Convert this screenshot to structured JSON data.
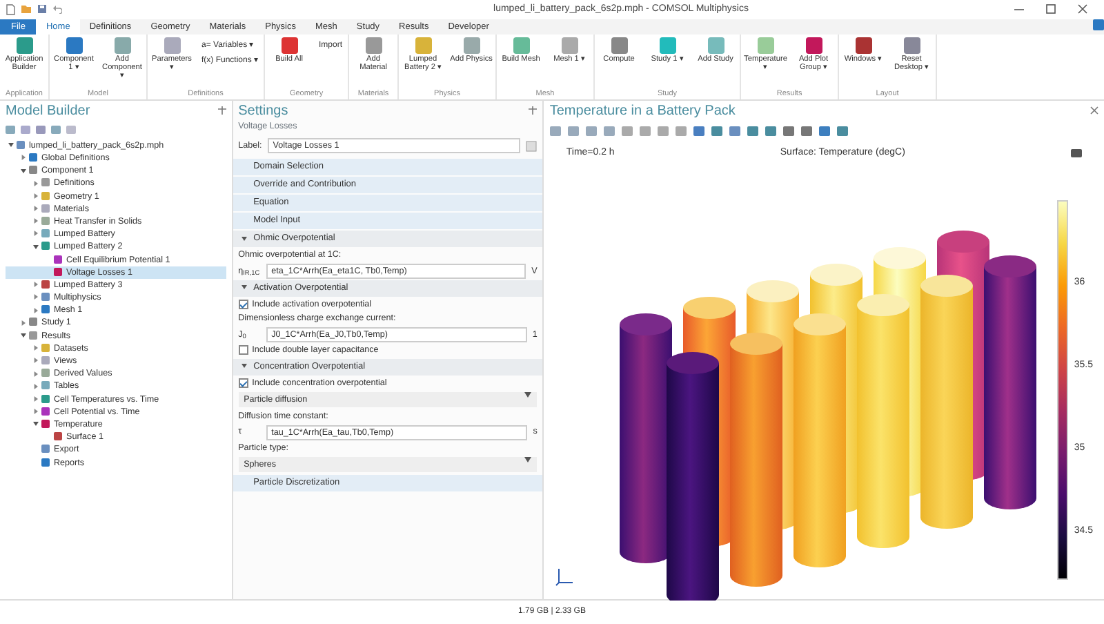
{
  "window": {
    "title": "lumped_li_battery_pack_6s2p.mph - COMSOL Multiphysics"
  },
  "menu_tabs": [
    {
      "label": "File",
      "kind": "file",
      "selected": false
    },
    {
      "label": "Home",
      "kind": "tab",
      "selected": true
    },
    {
      "label": "Definitions",
      "kind": "tab",
      "selected": false
    },
    {
      "label": "Geometry",
      "kind": "tab",
      "selected": false
    },
    {
      "label": "Materials",
      "kind": "tab",
      "selected": false
    },
    {
      "label": "Physics",
      "kind": "tab",
      "selected": false
    },
    {
      "label": "Mesh",
      "kind": "tab",
      "selected": false
    },
    {
      "label": "Study",
      "kind": "tab",
      "selected": false
    },
    {
      "label": "Results",
      "kind": "tab",
      "selected": false
    },
    {
      "label": "Developer",
      "kind": "tab",
      "selected": false
    }
  ],
  "ribbon": [
    {
      "label": "Application",
      "buttons": [
        {
          "label": "Application Builder",
          "kind": "large"
        }
      ]
    },
    {
      "label": "Model",
      "buttons": [
        {
          "label": "Component 1 ▾",
          "kind": "large"
        },
        {
          "label": "Add Component ▾",
          "kind": "large"
        }
      ]
    },
    {
      "label": "Definitions",
      "buttons": [
        {
          "label": "Parameters ▾",
          "kind": "large"
        },
        {
          "label": "a= Variables ▾",
          "kind": "small"
        },
        {
          "label": "f(x) Functions ▾",
          "kind": "small"
        }
      ]
    },
    {
      "label": "Geometry",
      "buttons": [
        {
          "label": "Build All",
          "kind": "large"
        },
        {
          "label": "Import",
          "kind": "small"
        }
      ]
    },
    {
      "label": "Materials",
      "buttons": [
        {
          "label": "Add Material",
          "kind": "large"
        }
      ]
    },
    {
      "label": "Physics",
      "buttons": [
        {
          "label": "Lumped Battery 2 ▾",
          "kind": "large"
        },
        {
          "label": "Add Physics",
          "kind": "large"
        }
      ]
    },
    {
      "label": "Mesh",
      "buttons": [
        {
          "label": "Build Mesh",
          "kind": "large"
        },
        {
          "label": "Mesh 1 ▾",
          "kind": "large"
        }
      ]
    },
    {
      "label": "Study",
      "buttons": [
        {
          "label": "Compute",
          "kind": "large"
        },
        {
          "label": "Study 1 ▾",
          "kind": "large"
        },
        {
          "label": "Add Study",
          "kind": "large"
        }
      ]
    },
    {
      "label": "Results",
      "buttons": [
        {
          "label": "Temperature ▾",
          "kind": "large"
        },
        {
          "label": "Add Plot Group ▾",
          "kind": "large"
        }
      ]
    },
    {
      "label": "Layout",
      "buttons": [
        {
          "label": "Windows ▾",
          "kind": "large"
        },
        {
          "label": "Reset Desktop ▾",
          "kind": "large"
        }
      ]
    }
  ],
  "model_builder": {
    "title": "Model Builder",
    "tree": [
      {
        "label": "lumped_li_battery_pack_6s2p.mph",
        "expanded": true,
        "selected": false,
        "children": [
          {
            "label": "Global Definitions",
            "expanded": false,
            "selected": false
          },
          {
            "label": "Component 1",
            "expanded": true,
            "selected": false,
            "children": [
              {
                "label": "Definitions",
                "expanded": false,
                "selected": false
              },
              {
                "label": "Geometry 1",
                "expanded": false,
                "selected": false
              },
              {
                "label": "Materials",
                "expanded": false,
                "selected": false
              },
              {
                "label": "Heat Transfer in Solids",
                "expanded": false,
                "selected": false
              },
              {
                "label": "Lumped Battery",
                "expanded": false,
                "selected": false
              },
              {
                "label": "Lumped Battery 2",
                "expanded": true,
                "selected": false,
                "children": [
                  {
                    "label": "Cell Equilibrium Potential 1",
                    "selected": false
                  },
                  {
                    "label": "Voltage Losses 1",
                    "selected": true
                  }
                ]
              },
              {
                "label": "Lumped Battery 3",
                "expanded": false,
                "selected": false
              },
              {
                "label": "Multiphysics",
                "expanded": false,
                "selected": false
              },
              {
                "label": "Mesh 1",
                "expanded": false,
                "selected": false
              }
            ]
          },
          {
            "label": "Study 1",
            "expanded": false,
            "selected": false
          },
          {
            "label": "Results",
            "expanded": true,
            "selected": false,
            "children": [
              {
                "label": "Datasets",
                "expanded": false,
                "selected": false
              },
              {
                "label": "Views",
                "expanded": false,
                "selected": false
              },
              {
                "label": "Derived Values",
                "expanded": false,
                "selected": false
              },
              {
                "label": "Tables",
                "expanded": false,
                "selected": false
              },
              {
                "label": "Cell Temperatures vs. Time",
                "expanded": false,
                "selected": false
              },
              {
                "label": "Cell Potential vs. Time",
                "expanded": false,
                "selected": false
              },
              {
                "label": "Temperature",
                "expanded": true,
                "selected": false,
                "children": [
                  {
                    "label": "Surface 1",
                    "selected": false
                  }
                ]
              },
              {
                "label": "Export",
                "selected": false
              },
              {
                "label": "Reports",
                "selected": false
              }
            ]
          }
        ]
      }
    ]
  },
  "settings": {
    "title": "Settings",
    "subtitle": "Voltage Losses",
    "label_caption": "Label:",
    "label_value": "Voltage Losses 1",
    "items": [
      {
        "kind": "section",
        "title": "Domain Selection",
        "expanded": false
      },
      {
        "kind": "section",
        "title": "Override and Contribution",
        "expanded": false
      },
      {
        "kind": "section",
        "title": "Equation",
        "expanded": false
      },
      {
        "kind": "section",
        "title": "Model Input",
        "expanded": false
      },
      {
        "kind": "section",
        "title": "Ohmic Overpotential",
        "expanded": true
      },
      {
        "kind": "text",
        "text": "Ohmic overpotential at 1C:"
      },
      {
        "kind": "input",
        "symbol": "η$_{IR,1C}$",
        "value": "eta_1C*Arrh(Ea_eta1C, Tb0,Temp)",
        "unit": "V"
      },
      {
        "kind": "section",
        "title": "Activation Overpotential",
        "expanded": true
      },
      {
        "kind": "checkbox",
        "label": "Include activation overpotential",
        "checked": true
      },
      {
        "kind": "text",
        "text": "Dimensionless charge exchange current:"
      },
      {
        "kind": "input",
        "symbol": "J$_{0}$",
        "value": "J0_1C*Arrh(Ea_J0,Tb0,Temp)",
        "unit": "1"
      },
      {
        "kind": "checkbox",
        "label": "Include double layer capacitance",
        "checked": false
      },
      {
        "kind": "section",
        "title": "Concentration Overpotential",
        "expanded": true
      },
      {
        "kind": "checkbox",
        "label": "Include concentration overpotential",
        "checked": true
      },
      {
        "kind": "select",
        "value": "Particle diffusion"
      },
      {
        "kind": "text",
        "text": "Diffusion time constant:"
      },
      {
        "kind": "input",
        "symbol": "τ",
        "value": "tau_1C*Arrh(Ea_tau,Tb0,Temp)",
        "unit": "s"
      },
      {
        "kind": "text",
        "text": "Particle type:"
      },
      {
        "kind": "select",
        "value": "Spheres"
      },
      {
        "kind": "section",
        "title": "Particle Discretization",
        "expanded": false
      }
    ]
  },
  "graphics": {
    "title": "Temperature in a Battery Pack",
    "time_label": "Time=0.2 h",
    "plot_title": "Surface: Temperature (degC)",
    "color_legend": [
      "36",
      "35.5",
      "35",
      "34.5"
    ]
  },
  "status_bar": {
    "memory": "1.79 GB | 2.33 GB"
  }
}
